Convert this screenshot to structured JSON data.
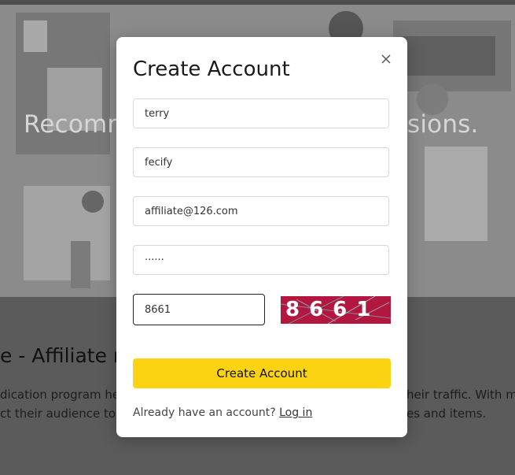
{
  "hero": {
    "heading_left": "Recomm",
    "heading_right": "issions."
  },
  "section": {
    "title": "e - Affiliate m",
    "line1_left": "dication program helps",
    "line1_right": "heir traffic. With mil",
    "line2_left": "ct their audience to the",
    "line2_right": "es and items."
  },
  "modal": {
    "title": "Create Account",
    "fields": {
      "first_name": "terry",
      "last_name": "fecify",
      "email": "affiliate@126.com",
      "password": "······",
      "captcha_input": "8661"
    },
    "captcha_text": "8661",
    "submit_label": "Create Account",
    "login_prompt": "Already have an account?",
    "login_link": "Log in"
  },
  "colors": {
    "accent": "#fcd313",
    "captcha_bg": "#b3163e",
    "overlay": "#5f5f5f"
  },
  "icons": {
    "close": "close-icon"
  }
}
